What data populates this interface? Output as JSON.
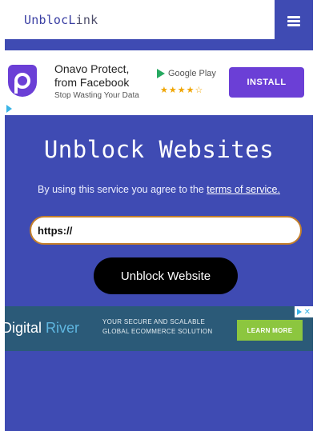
{
  "header": {
    "logo_main": "UnblocL",
    "logo_dim": "ink",
    "menu_icon": "hamburger-menu-icon"
  },
  "ad_top": {
    "icon": "onavo-shield-icon",
    "title": "Onavo Protect, from Facebook",
    "subtitle": "Stop Wasting Your Data",
    "store_label": "Google Play",
    "rating_stars": "★★★★☆",
    "install_label": "INSTALL",
    "choices_icon": "adchoices-icon"
  },
  "main": {
    "title": "Unblock Websites",
    "terms_prefix": "By using this service you agree to the ",
    "terms_link": "terms of service.",
    "url_value": "https://",
    "submit_label": "Unblock Website"
  },
  "ad_bottom": {
    "brand_left": "Digital ",
    "brand_accent": "River",
    "copy_line1": "YOUR SECURE AND SCALABLE",
    "copy_line2": "GLOBAL ECOMMERCE SOLUTION",
    "cta_label": "LEARN MORE",
    "badge_icon": "adchoices-icon",
    "close_label": "✕"
  },
  "colors": {
    "background": "#3f4bb3",
    "header_bg": "#ffffff",
    "install_button": "#6b3fd6",
    "submit_button": "#000000",
    "ad2_bg": "#2b5a78",
    "ad2_cta": "#8cc63f"
  }
}
